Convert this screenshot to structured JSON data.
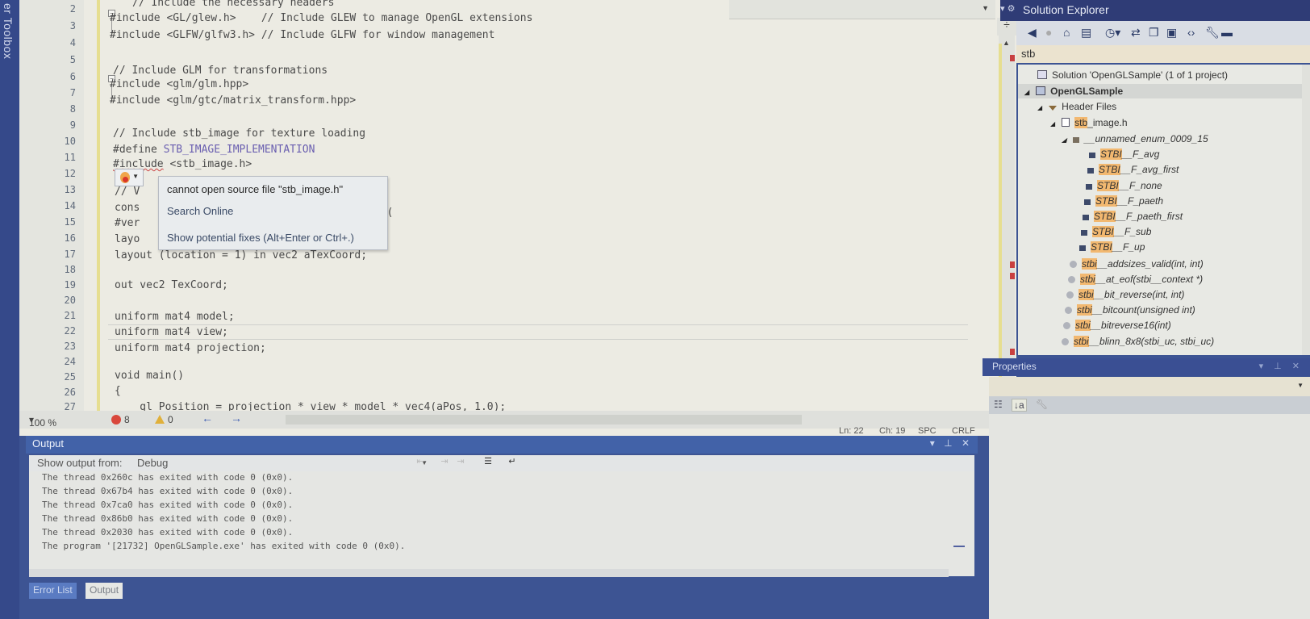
{
  "side_strip": {
    "label": "er Toolbox"
  },
  "editor": {
    "line_numbers": [
      "2",
      "3",
      "4",
      "5",
      "6",
      "7",
      "8",
      "9",
      "10",
      "11",
      "12",
      "13",
      "14",
      "15",
      "16",
      "17",
      "18",
      "19",
      "20",
      "21",
      "22",
      "23",
      "24",
      "25",
      "26",
      "27"
    ],
    "lines": {
      "l1": "// Include the necessary headers",
      "l2a": "#include <GL/glew.h>",
      "l2b": "// Include GLEW to manage OpenGL extensions",
      "l3a": "#include <GLFW/glfw3.h>",
      "l3b": "// Include GLFW for window management",
      "l5": "// Include GLM for transformations",
      "l6": "#include <glm/glm.hpp>",
      "l7": "#include <glm/gtc/matrix_transform.hpp>",
      "l9": "// Include stb_image for texture loading",
      "l10a": "#define ",
      "l10b": "STB_IMAGE_IMPLEMENTATION",
      "l11a": "#include",
      "l11b": " <stb_image.h>",
      "l13": "// V",
      "l14a": "cons",
      "l14b": "sl(",
      "l15": "#ver",
      "l16": "layo",
      "l17": "layout (location = 1) in vec2 aTexCoord;",
      "l19": "out vec2 TexCoord;",
      "l21": "uniform mat4 model;",
      "l22": "uniform mat4 view;",
      "l23": "uniform mat4 projection;",
      "l25": "void main()",
      "l26": "{",
      "l27": "    gl_Position = projection * view * model * vec4(aPos, 1.0);"
    },
    "quick_info": {
      "error": "cannot open source file \"stb_image.h\"",
      "search": "Search Online",
      "fixes": "Show potential fixes (Alt+Enter or Ctrl+.)"
    },
    "status": {
      "zoom": "100 %",
      "errors": "8",
      "warnings": "0",
      "back": "←",
      "forward": "→",
      "line": "Ln: 22",
      "col": "Ch: 19",
      "indent": "SPC",
      "eol": "CRLF"
    }
  },
  "output": {
    "title": "Output",
    "controls": "▾ ⊥ ✕",
    "show_from_label": "Show output from:",
    "source": "Debug",
    "lines": [
      "The thread 0x260c has exited with code 0 (0x0).",
      "The thread 0x67b4 has exited with code 0 (0x0).",
      "The thread 0x7ca0 has exited with code 0 (0x0).",
      "The thread 0x86b0 has exited with code 0 (0x0).",
      "The thread 0x2030 has exited with code 0 (0x0).",
      "The program '[21732] OpenGLSample.exe' has exited with code 0 (0x0)."
    ],
    "tabs": [
      "Error List",
      "Output"
    ]
  },
  "solution_explorer": {
    "title": "Solution Explorer",
    "search_value": "stb",
    "solution": "Solution 'OpenGLSample' (1 of 1 project)",
    "project": "OpenGLSample",
    "folder": "Header Files",
    "file_hl": "stb",
    "file_rest": "_image.h",
    "enum": "__unnamed_enum_0009_15",
    "members": [
      {
        "hl": "STBI",
        "rest": "__F_avg"
      },
      {
        "hl": "STBI",
        "rest": "__F_avg_first"
      },
      {
        "hl": "STBI",
        "rest": "__F_none"
      },
      {
        "hl": "STBI",
        "rest": "__F_paeth"
      },
      {
        "hl": "STBI",
        "rest": "__F_paeth_first"
      },
      {
        "hl": "STBI",
        "rest": "__F_sub"
      },
      {
        "hl": "STBI",
        "rest": "__F_up"
      }
    ],
    "functions": [
      {
        "hl": "stbi",
        "rest": "__addsizes_valid(int, int)"
      },
      {
        "hl": "stbi",
        "rest": "__at_eof(stbi__context *)"
      },
      {
        "hl": "stbi",
        "rest": "__bit_reverse(int, int)"
      },
      {
        "hl": "stbi",
        "rest": "__bitcount(unsigned int)"
      },
      {
        "hl": "stbi",
        "rest": "__bitreverse16(int)"
      },
      {
        "hl": "stbi",
        "rest": "__blinn_8x8(stbi_uc, stbi_uc)"
      }
    ]
  },
  "properties": {
    "title": "Properties",
    "controls": "▾ ⊥ ✕"
  }
}
